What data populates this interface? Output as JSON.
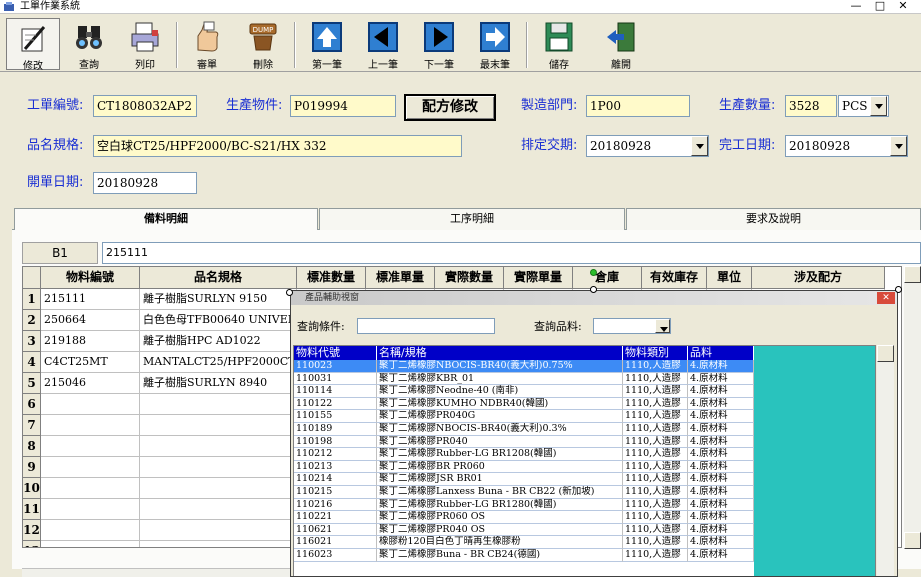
{
  "window": {
    "title": "工單作業系統",
    "minimize": "—",
    "maximize": "□",
    "close": "✕"
  },
  "toolbar": [
    {
      "label": "修改",
      "icon": "edit-pen-icon",
      "active": true
    },
    {
      "label": "查詢",
      "icon": "binoculars-icon"
    },
    {
      "label": "列印",
      "icon": "printer-icon"
    },
    {
      "label": "審單",
      "icon": "approve-hand-icon"
    },
    {
      "label": "刪除",
      "icon": "delete-dump-icon"
    },
    {
      "label": "第一筆",
      "icon": "arrow-up-first-icon"
    },
    {
      "label": "上一筆",
      "icon": "arrow-left-prev-icon"
    },
    {
      "label": "下一筆",
      "icon": "arrow-right-next-icon"
    },
    {
      "label": "最末筆",
      "icon": "arrow-last-icon"
    },
    {
      "label": "儲存",
      "icon": "floppy-save-icon"
    },
    {
      "label": "離開",
      "icon": "exit-door-icon"
    }
  ],
  "form": {
    "order_no_label": "工單編號:",
    "order_no": "CT1808032AP2",
    "product_label": "生產物件:",
    "product": "P019994",
    "recipe_button": "配方修改",
    "dept_label": "製造部門:",
    "dept": "1P00",
    "qty_label": "生產數量:",
    "qty": "3528",
    "unit": "PCS",
    "spec_label": "品名規格:",
    "spec": "空白球CT25/HPF2000/BC-S21/HX 332",
    "due_label": "排定交期:",
    "due_date": "20180928",
    "finish_label": "完工日期:",
    "finish_date": "20180928",
    "open_label": "開單日期:",
    "open_date": "20180928"
  },
  "tabs": [
    "備料明細",
    "工序明細",
    "要求及說明"
  ],
  "grid": {
    "cell_ref": "B1",
    "formula": "215111",
    "columns": [
      "物料編號",
      "品名規格",
      "標准數量",
      "標准單量",
      "實際數量",
      "實際單量",
      "倉庫",
      "有效庫存",
      "單位",
      "涉及配方"
    ],
    "rows": [
      {
        "n": "1",
        "code": "215111",
        "spec": "離子樹脂SURLYN 9150"
      },
      {
        "n": "2",
        "code": "250664",
        "spec": "白色色母TFB00640 UNIVERS"
      },
      {
        "n": "3",
        "code": "219188",
        "spec": "離子樹脂HPC AD1022"
      },
      {
        "n": "4",
        "code": "C4CT25MT",
        "spec": "MANTALCT25/HPF2000CT25"
      },
      {
        "n": "5",
        "code": "215046",
        "spec": "離子樹脂SURLYN 8940"
      },
      {
        "n": "6",
        "code": "",
        "spec": ""
      },
      {
        "n": "7",
        "code": "",
        "spec": ""
      },
      {
        "n": "8",
        "code": "",
        "spec": ""
      },
      {
        "n": "9",
        "code": "",
        "spec": ""
      },
      {
        "n": "10",
        "code": "",
        "spec": ""
      },
      {
        "n": "11",
        "code": "",
        "spec": ""
      },
      {
        "n": "12",
        "code": "",
        "spec": ""
      },
      {
        "n": "13",
        "code": "",
        "spec": ""
      }
    ]
  },
  "popup": {
    "title": "產品輔助視窗",
    "query_cond_label": "查詢條件:",
    "query_type_label": "查詢品料:",
    "columns": [
      "物料代號",
      "名稱/規格",
      "物料類別",
      "品料"
    ],
    "rows": [
      [
        "110023",
        "聚丁二烯橡膠NBOCIS-BR40(義大利)0.75%",
        "1110,人造膠",
        "4.原材料"
      ],
      [
        "110031",
        "聚丁二烯橡膠KBR_01",
        "1110,人造膠",
        "4.原材料"
      ],
      [
        "110114",
        "聚丁二烯橡膠Neodne-40 (南非)",
        "1110,人造膠",
        "4.原材料"
      ],
      [
        "110122",
        "聚丁二烯橡膠KUMHO NDBR40(韓國)",
        "1110,人造膠",
        "4.原材料"
      ],
      [
        "110155",
        "聚丁二烯橡膠PR040G",
        "1110,人造膠",
        "4.原材料"
      ],
      [
        "110189",
        "聚丁二烯橡膠NBOCIS-BR40(義大利)0.3%",
        "1110,人造膠",
        "4.原材料"
      ],
      [
        "110198",
        "聚丁二烯橡膠PR040",
        "1110,人造膠",
        "4.原材料"
      ],
      [
        "110212",
        "聚丁二烯橡膠Rubber-LG BR1208(韓國)",
        "1110,人造膠",
        "4.原材料"
      ],
      [
        "110213",
        "聚丁二烯橡膠BR PR060",
        "1110,人造膠",
        "4.原材料"
      ],
      [
        "110214",
        "聚丁二烯橡膠JSR BR01",
        "1110,人造膠",
        "4.原材料"
      ],
      [
        "110215",
        "聚丁二烯橡膠Lanxess Buna - BR CB22 (新加坡)",
        "1110,人造膠",
        "4.原材料"
      ],
      [
        "110216",
        "聚丁二烯橡膠Rubber-LG BR1280(韓國)",
        "1110,人造膠",
        "4.原材料"
      ],
      [
        "110221",
        "聚丁二烯橡膠PR060 OS",
        "1110,人造膠",
        "4.原材料"
      ],
      [
        "110621",
        "聚丁二烯橡膠PR040 OS",
        "1110,人造膠",
        "4.原材料"
      ],
      [
        "116021",
        "橡膠粉120目白色丁晴再生橡膠粉",
        "1110,人造膠",
        "4.原材料"
      ],
      [
        "116023",
        "聚丁二烯橡膠Buna - BR CB24(德國)",
        "1110,人造膠",
        "4.原材料"
      ]
    ]
  }
}
